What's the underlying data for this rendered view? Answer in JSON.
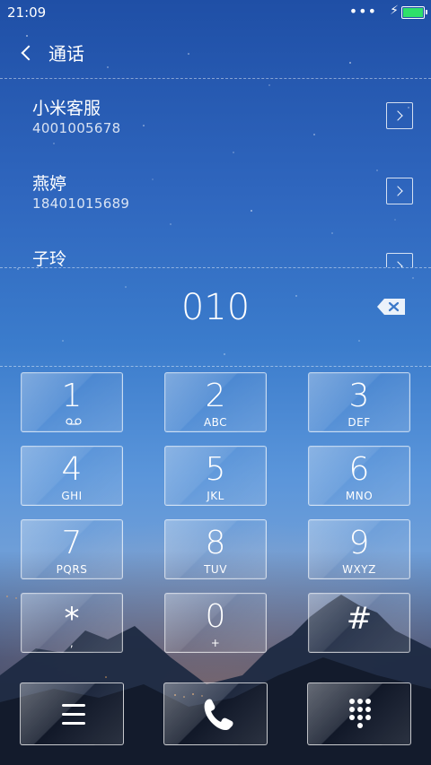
{
  "status_bar": {
    "time": "21:09",
    "signal_dots": "•••",
    "charging_icon": "charging-bolt-icon",
    "battery_color": "#2ee06a"
  },
  "header": {
    "title": "通话"
  },
  "contacts": [
    {
      "name": "小米客服",
      "number": "4001005678"
    },
    {
      "name": "燕婷",
      "number": "18401015689"
    },
    {
      "name": "子玲",
      "number": ""
    }
  ],
  "display": {
    "digits": "010"
  },
  "keypad": [
    {
      "num": "1",
      "letters": "",
      "icon": "voicemail-icon"
    },
    {
      "num": "2",
      "letters": "ABC"
    },
    {
      "num": "3",
      "letters": "DEF"
    },
    {
      "num": "4",
      "letters": "GHI"
    },
    {
      "num": "5",
      "letters": "JKL"
    },
    {
      "num": "6",
      "letters": "MNO"
    },
    {
      "num": "7",
      "letters": "PQRS"
    },
    {
      "num": "8",
      "letters": "TUV"
    },
    {
      "num": "9",
      "letters": "WXYZ"
    },
    {
      "num": "*",
      "letters": ","
    },
    {
      "num": "0",
      "letters": "+"
    },
    {
      "num": "#",
      "letters": ""
    }
  ],
  "bottom_bar": {
    "left_icon": "menu-icon",
    "center_icon": "call-icon",
    "right_icon": "dialpad-icon"
  }
}
